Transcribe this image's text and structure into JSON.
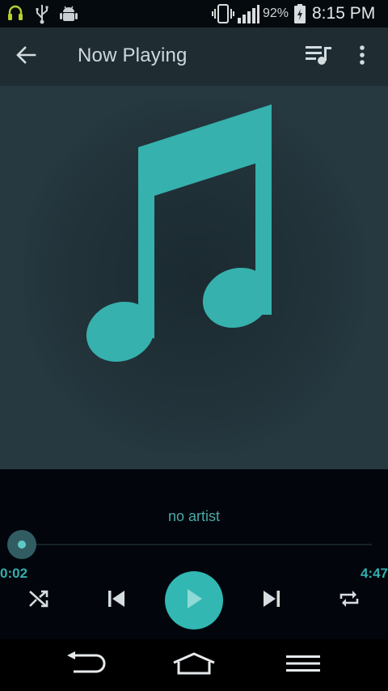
{
  "status_bar": {
    "battery_percent": "92%",
    "time": "8:15 PM",
    "icons": [
      "headset-icon",
      "usb-icon",
      "android-debug-icon",
      "vibrate-icon",
      "signal-icon",
      "battery-charging-icon"
    ]
  },
  "app_bar": {
    "title": "Now Playing",
    "icons": [
      "back-arrow-icon",
      "queue-music-icon",
      "more-vert-icon"
    ]
  },
  "album_art": {
    "icon": "music-note-icon"
  },
  "player": {
    "artist": "no artist",
    "elapsed": "0:02",
    "duration": "4:47",
    "progress": 0.007,
    "controls": [
      "shuffle-icon",
      "previous-icon",
      "play-icon",
      "next-icon",
      "repeat-icon"
    ]
  },
  "colors": {
    "accent": "#32b7b2",
    "app_bar": "#1f2d33",
    "art_background": "#263840",
    "panel_background": "#02060c"
  }
}
